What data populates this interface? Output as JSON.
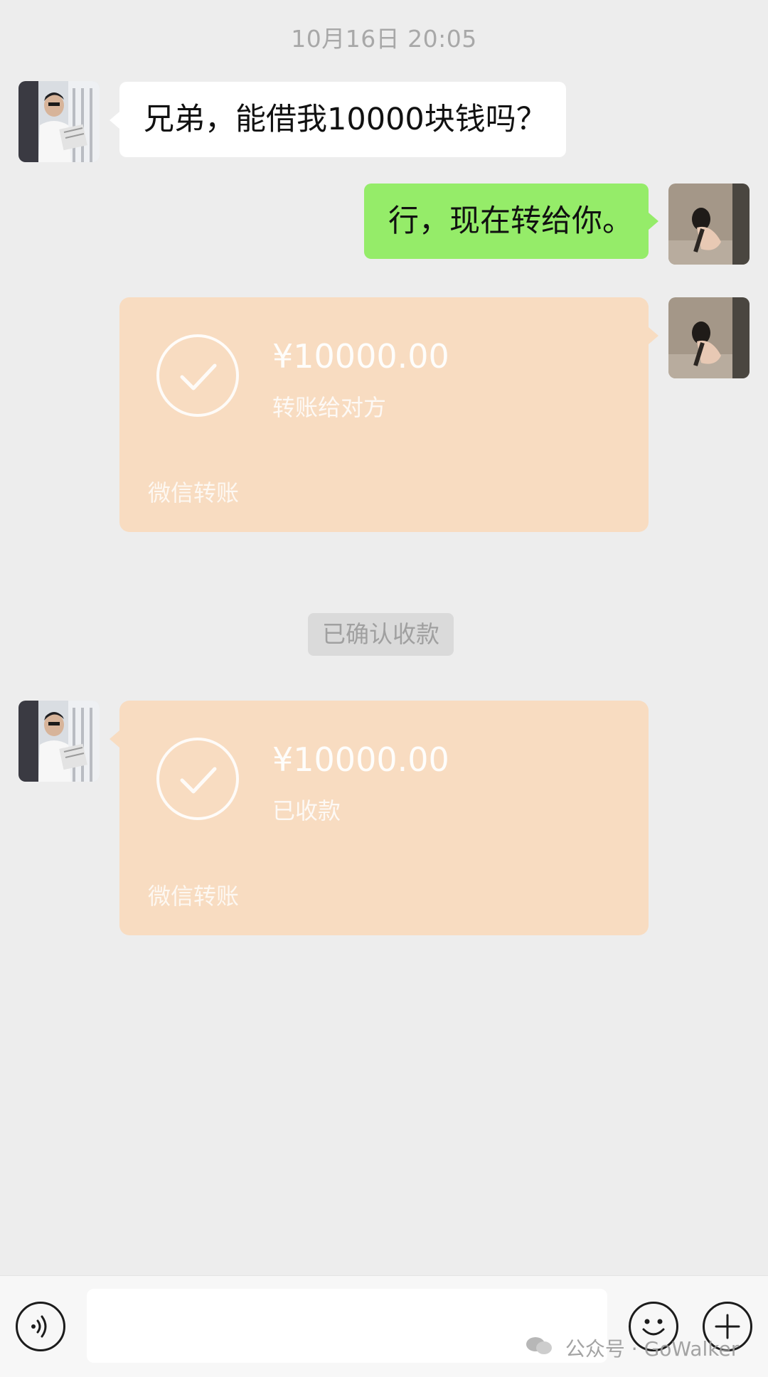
{
  "chat": {
    "timestamp": "10月16日 20:05",
    "messages": [
      {
        "side": "left",
        "text": "兄弟，能借我10000块钱吗？"
      },
      {
        "side": "right",
        "text": "行，现在转给你。"
      }
    ],
    "transfer_sent": {
      "amount": "¥10000.00",
      "status": "转账给对方",
      "brand": "微信转账"
    },
    "system_note": "已确认收款",
    "transfer_received": {
      "amount": "¥10000.00",
      "status": "已收款",
      "brand": "微信转账"
    }
  },
  "input_bar": {
    "voice_icon": "voice-icon",
    "emoji_icon": "emoji-icon",
    "plus_icon": "plus-icon"
  },
  "watermark": {
    "text": "公众号 · GoWalker"
  },
  "colors": {
    "background": "#ededed",
    "green_bubble": "#95ec69",
    "transfer_card": "#f8dcc1"
  }
}
